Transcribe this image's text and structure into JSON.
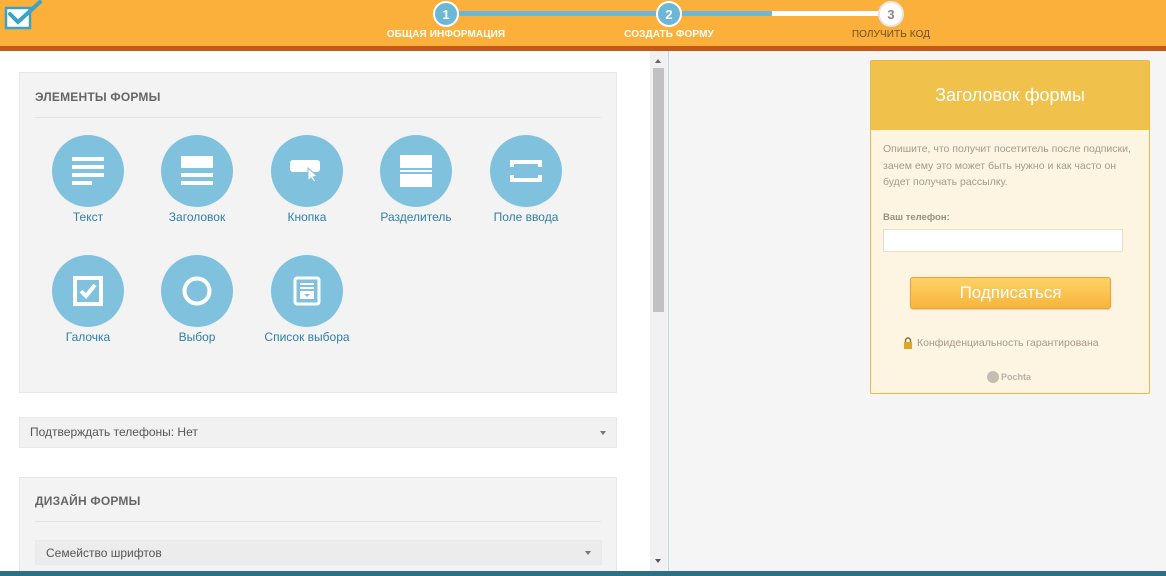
{
  "steps": [
    {
      "number": "1",
      "label": "ОБЩАЯ ИНФОРМАЦИЯ",
      "state": "done"
    },
    {
      "number": "2",
      "label": "СОЗДАТЬ ФОРМУ",
      "state": "active"
    },
    {
      "number": "3",
      "label": "ПОЛУЧИТЬ КОД",
      "state": "todo"
    }
  ],
  "colors": {
    "header": "#fbb03b",
    "header_line": "#c45a17",
    "element_circle": "#80c2de",
    "element_label": "#2f7fa6",
    "preview_head": "#f0c24b",
    "preview_bg": "#fdf4e1",
    "footer": "#2e6e86"
  },
  "form_elements": {
    "title": "ЭЛЕМЕНТЫ ФОРМЫ",
    "items": [
      {
        "label": "Текст",
        "icon": "text-lines-icon"
      },
      {
        "label": "Заголовок",
        "icon": "heading-icon"
      },
      {
        "label": "Кнопка",
        "icon": "button-cursor-icon"
      },
      {
        "label": "Разделитель",
        "icon": "divider-icon"
      },
      {
        "label": "Поле ввода",
        "icon": "input-field-icon"
      },
      {
        "label": "Галочка",
        "icon": "checkbox-icon"
      },
      {
        "label": "Выбор",
        "icon": "radio-circle-icon"
      },
      {
        "label": "Список выбора",
        "icon": "dropdown-list-icon"
      }
    ]
  },
  "confirm_phones": {
    "value": "Подтверждать телефоны: Нет"
  },
  "form_design": {
    "title": "ДИЗАЙН ФОРМЫ",
    "font_family": "Семейство шрифтов"
  },
  "preview": {
    "title": "Заголовок формы",
    "description": "Опишите, что получит посетитель после подписки, зачем ему это может быть нужно и как часто он будет получать рассылку.",
    "phone_label": "Ваш телефон:",
    "phone_value": "",
    "submit_label": "Подписаться",
    "privacy_text": "Конфиденциальность гарантирована",
    "brand": "Pochta"
  }
}
